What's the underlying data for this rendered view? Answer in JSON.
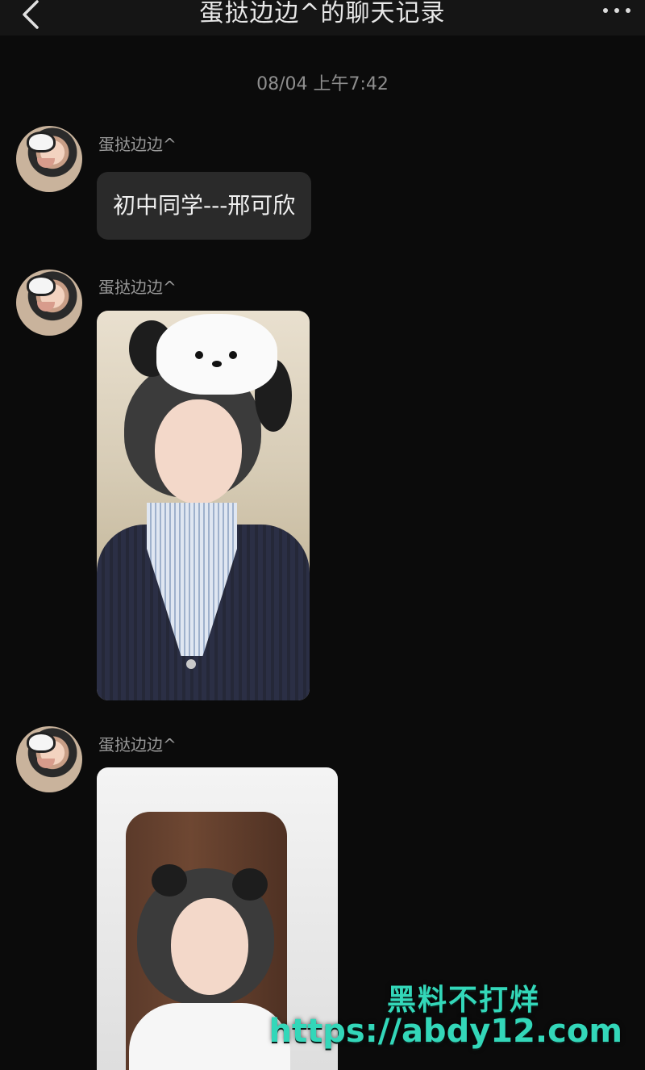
{
  "header": {
    "title": "蛋挞边边^的聊天记录",
    "back_icon": "chevron-left-icon",
    "more_icon": "more-dots-icon"
  },
  "timestamp": "08/04 上午7:42",
  "messages": [
    {
      "sender": "蛋挞边边^",
      "type": "text",
      "text": "初中同学---邢可欣"
    },
    {
      "sender": "蛋挞边边^",
      "type": "image"
    },
    {
      "sender": "蛋挞边边^",
      "type": "image"
    }
  ],
  "watermark": {
    "line1": "黑料不打烊",
    "line2": "https://abdy12.com"
  },
  "colors": {
    "background": "#0b0b0b",
    "bubble": "#2a2a2a",
    "watermark": "#33d7b9"
  }
}
